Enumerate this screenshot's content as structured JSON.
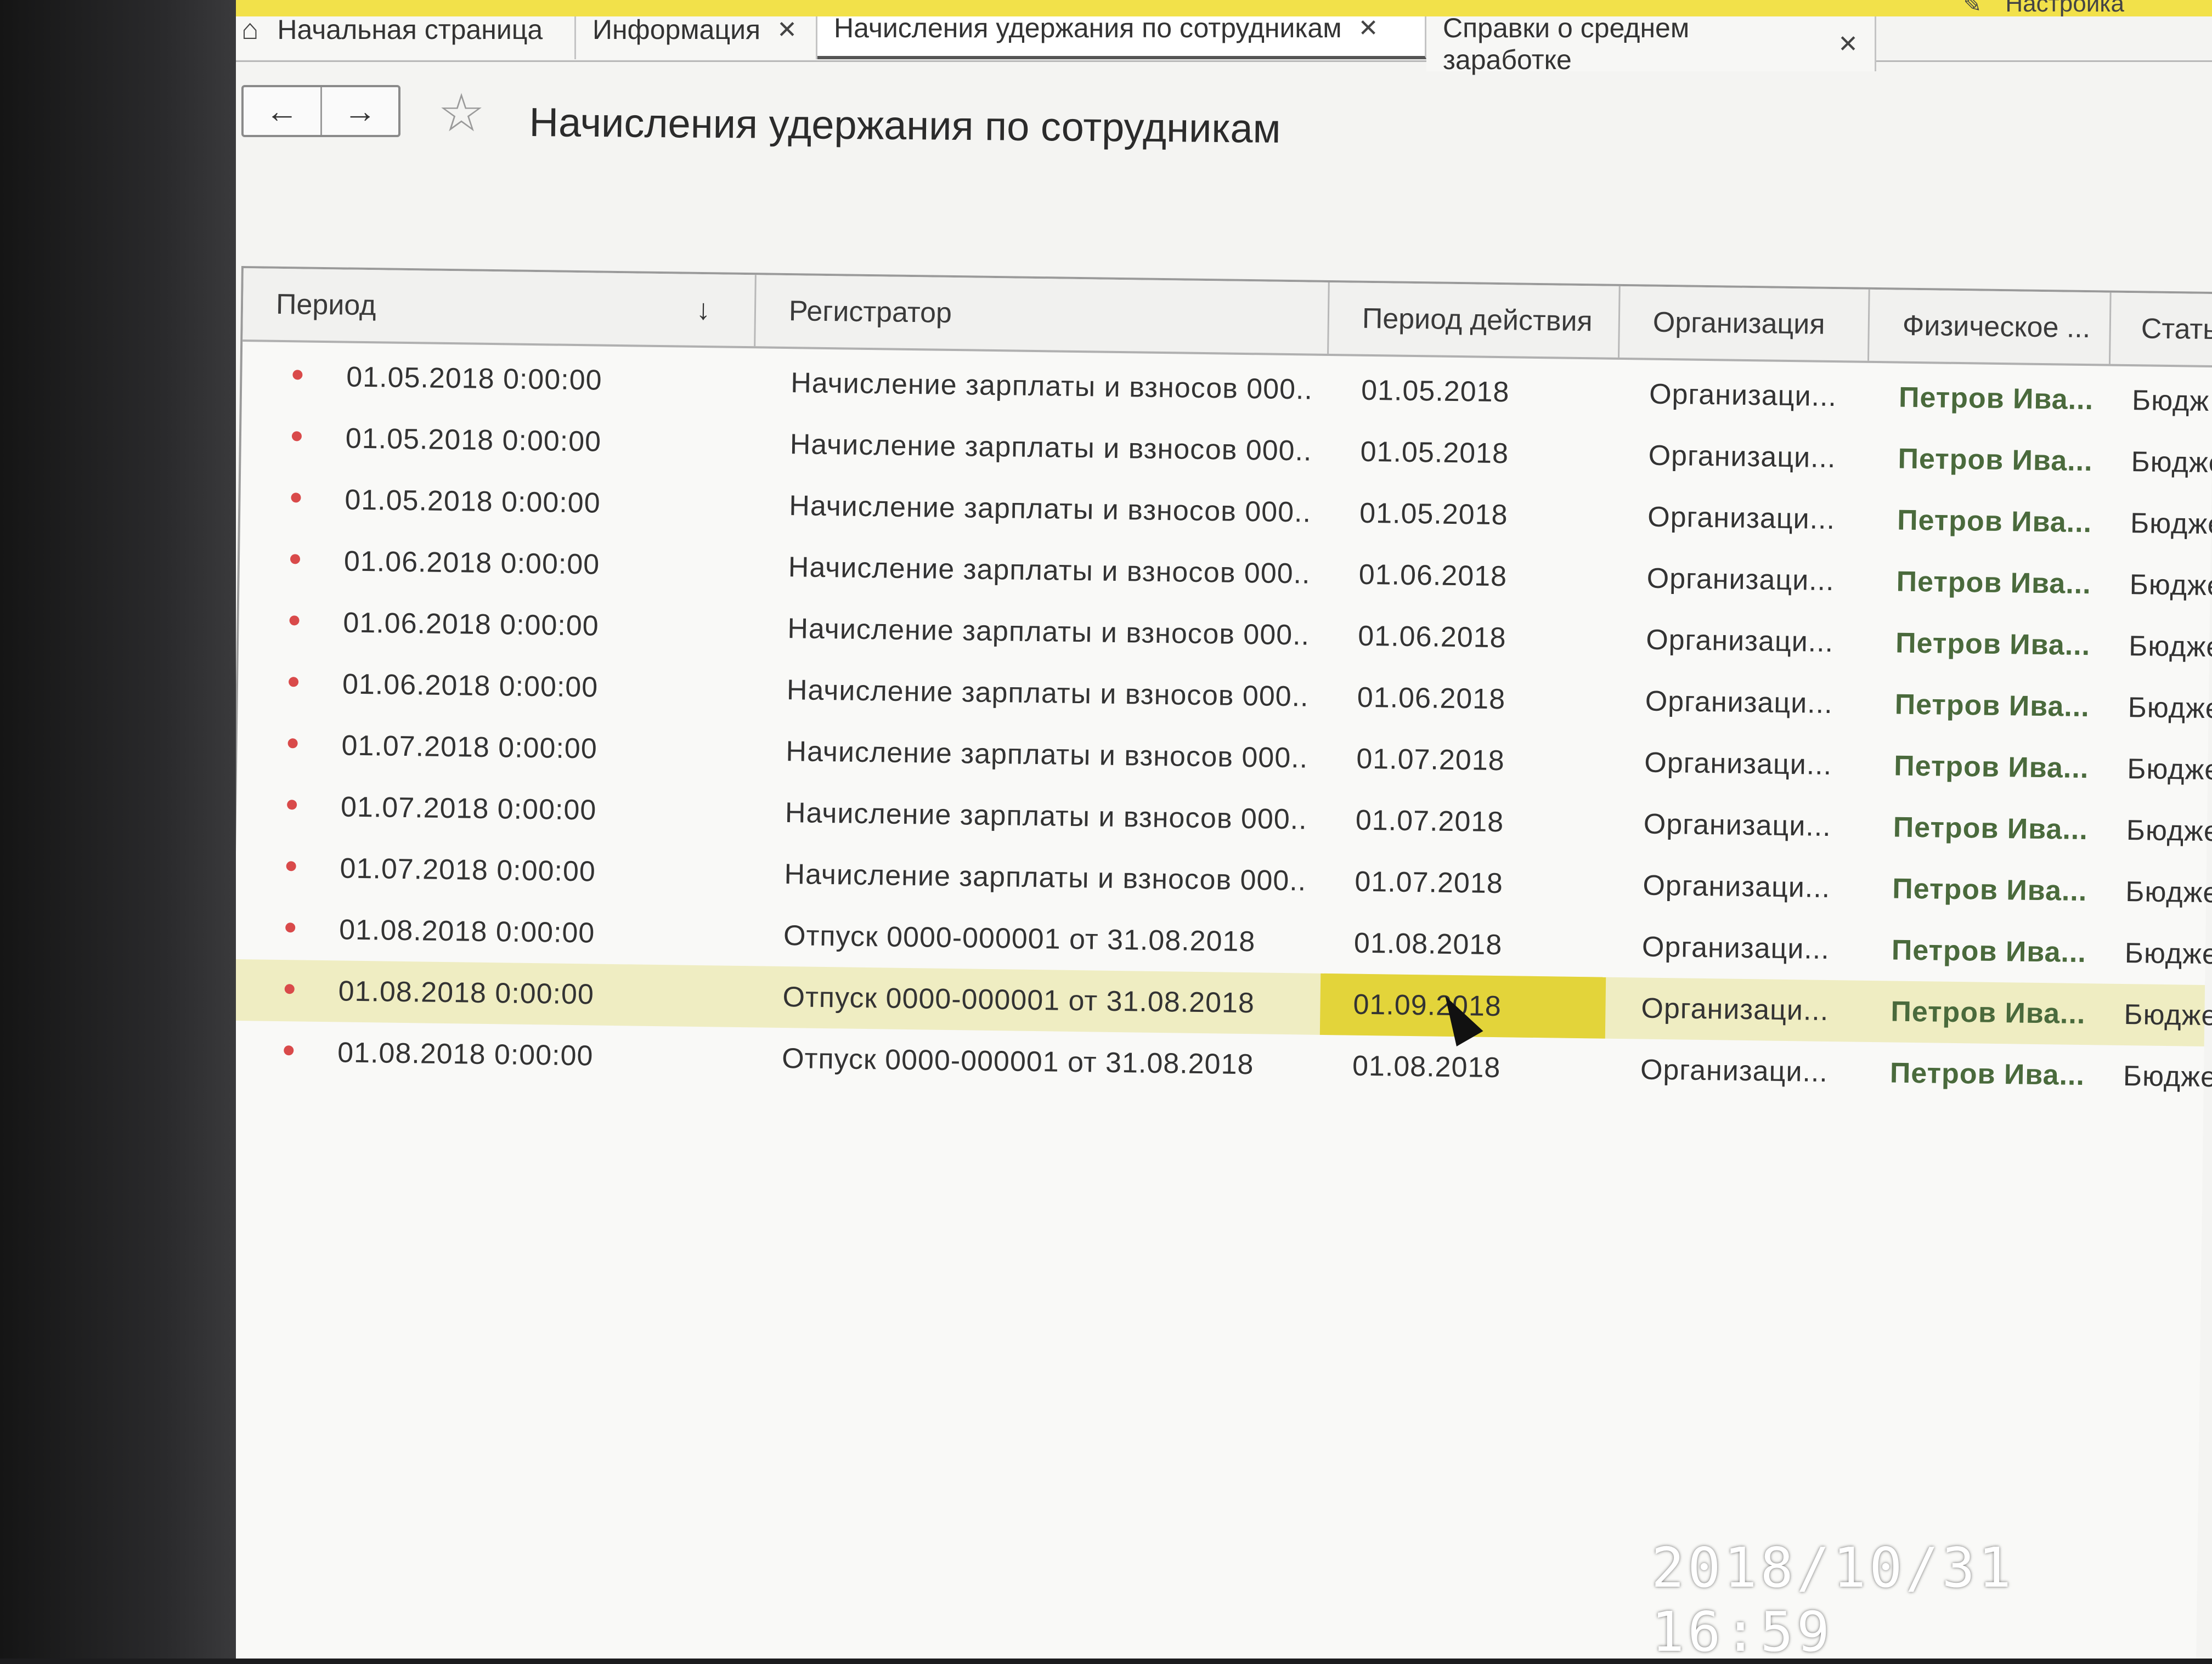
{
  "top": {
    "right_label": "Настройка"
  },
  "tabs": [
    {
      "label": "Начальная страница",
      "closable": false,
      "icon": "home-icon"
    },
    {
      "label": "Информация",
      "closable": true
    },
    {
      "label": "Начисления удержания по сотрудникам",
      "closable": true,
      "active": true
    },
    {
      "label": "Справки о среднем заработке",
      "closable": true
    }
  ],
  "header": {
    "back_icon": "←",
    "forward_icon": "→",
    "star_icon": "☆",
    "title": "Начисления удержания по сотрудникам"
  },
  "table": {
    "columns": [
      "Период",
      "Регистратор",
      "Период действия",
      "Организация",
      "Физическое ...",
      "Статья"
    ],
    "sort_indicator": "↓",
    "rows": [
      {
        "period": "01.05.2018 0:00:00",
        "registrator": "Начисление зарплаты и взносов 000...",
        "action_period": "01.05.2018",
        "org": "Организаци...",
        "person": "Петров Ива...",
        "article": "Бюдж"
      },
      {
        "period": "01.05.2018 0:00:00",
        "registrator": "Начисление зарплаты и взносов 000...",
        "action_period": "01.05.2018",
        "org": "Организаци...",
        "person": "Петров Ива...",
        "article": "Бюдже"
      },
      {
        "period": "01.05.2018 0:00:00",
        "registrator": "Начисление зарплаты и взносов 000...",
        "action_period": "01.05.2018",
        "org": "Организаци...",
        "person": "Петров Ива...",
        "article": "Бюдже"
      },
      {
        "period": "01.06.2018 0:00:00",
        "registrator": "Начисление зарплаты и взносов 000...",
        "action_period": "01.06.2018",
        "org": "Организаци...",
        "person": "Петров Ива...",
        "article": "Бюдже"
      },
      {
        "period": "01.06.2018 0:00:00",
        "registrator": "Начисление зарплаты и взносов 000...",
        "action_period": "01.06.2018",
        "org": "Организаци...",
        "person": "Петров Ива...",
        "article": "Бюдже"
      },
      {
        "period": "01.06.2018 0:00:00",
        "registrator": "Начисление зарплаты и взносов 000...",
        "action_period": "01.06.2018",
        "org": "Организаци...",
        "person": "Петров Ива...",
        "article": "Бюдже"
      },
      {
        "period": "01.07.2018 0:00:00",
        "registrator": "Начисление зарплаты и взносов 000...",
        "action_period": "01.07.2018",
        "org": "Организаци...",
        "person": "Петров Ива...",
        "article": "Бюджет"
      },
      {
        "period": "01.07.2018 0:00:00",
        "registrator": "Начисление зарплаты и взносов 000...",
        "action_period": "01.07.2018",
        "org": "Организаци...",
        "person": "Петров Ива...",
        "article": "Бюджет"
      },
      {
        "period": "01.07.2018 0:00:00",
        "registrator": "Начисление зарплаты и взносов 000...",
        "action_period": "01.07.2018",
        "org": "Организаци...",
        "person": "Петров Ива...",
        "article": "Бюджет"
      },
      {
        "period": "01.08.2018 0:00:00",
        "registrator": "Отпуск 0000-000001 от 31.08.2018",
        "action_period": "01.08.2018",
        "org": "Организаци...",
        "person": "Петров Ива...",
        "article": "Бюджети"
      },
      {
        "period": "01.08.2018 0:00:00",
        "registrator": "Отпуск 0000-000001 от 31.08.2018",
        "action_period": "01.09.2018",
        "org": "Организаци...",
        "person": "Петров Ива...",
        "article": "Бюджетн",
        "selected": true
      },
      {
        "period": "01.08.2018 0:00:00",
        "registrator": "Отпуск 0000-000001 от 31.08.2018",
        "action_period": "01.08.2018",
        "org": "Организаци...",
        "person": "Петров Ива...",
        "article": "Бюджетн"
      }
    ]
  },
  "photo_timestamp": "2018/10/31  16:59",
  "colors": {
    "highlight": "#e3d43a",
    "selected_row": "#efedc2",
    "person_text": "#4a6a3c",
    "marker": "#d94a4a"
  }
}
